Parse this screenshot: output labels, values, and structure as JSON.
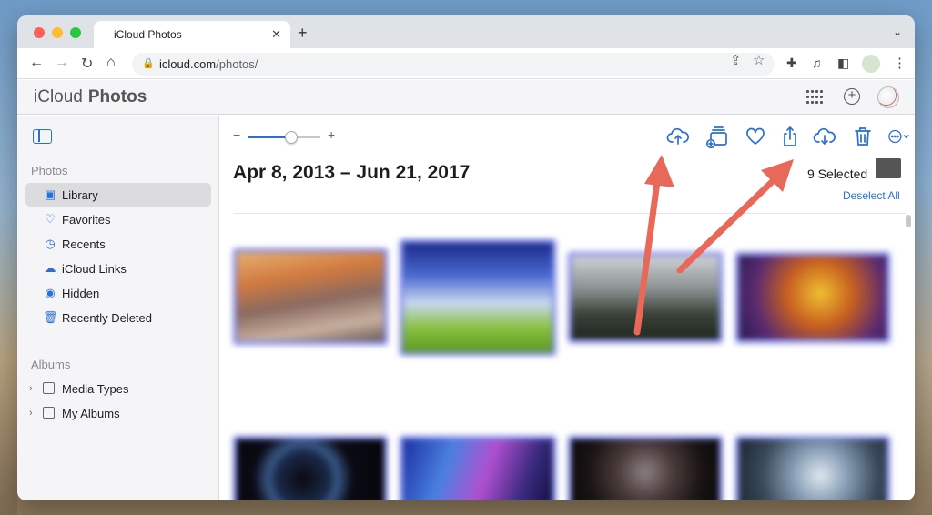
{
  "browser": {
    "tab_title": "iCloud Photos",
    "tab_close": "✕",
    "new_tab": "+",
    "tab_menu": "⌄",
    "url_host": "icloud.com",
    "url_path": "/photos/",
    "nav_icons": {
      "back": "←",
      "forward": "→",
      "reload": "↻",
      "home": "⌂"
    },
    "kebab": "⋮"
  },
  "app": {
    "apple_logo": "",
    "brand_icloud": "iCloud",
    "brand_photos": "Photos"
  },
  "sidebar": {
    "photos_label": "Photos",
    "items": [
      {
        "label": "Library",
        "icon": "library-icon",
        "glyph": "▣",
        "active": true
      },
      {
        "label": "Favorites",
        "icon": "heart-icon",
        "glyph": "♡"
      },
      {
        "label": "Recents",
        "icon": "clock-icon",
        "glyph": "◷"
      },
      {
        "label": "iCloud Links",
        "icon": "cloud-link-icon",
        "glyph": "☁"
      },
      {
        "label": "Hidden",
        "icon": "eye-icon",
        "glyph": "◉"
      },
      {
        "label": "Recently Deleted",
        "icon": "trash-icon",
        "glyph": "🗑"
      }
    ],
    "albums_label": "Albums",
    "album_groups": [
      {
        "label": "Media Types",
        "chevron": "›"
      },
      {
        "label": "My Albums",
        "chevron": "›"
      }
    ]
  },
  "toolbar": {
    "zoom_minus": "−",
    "zoom_plus": "+",
    "zoom_level": 0.6
  },
  "main": {
    "date_range": "Apr 8, 2013 – Jun 21, 2017",
    "selected_count": "9 Selected",
    "deselect_all": "Deselect All"
  },
  "colors": {
    "accent": "#2a6fd6",
    "selection_border": "#7a84e8",
    "annotation_arrow": "#e8695a"
  }
}
